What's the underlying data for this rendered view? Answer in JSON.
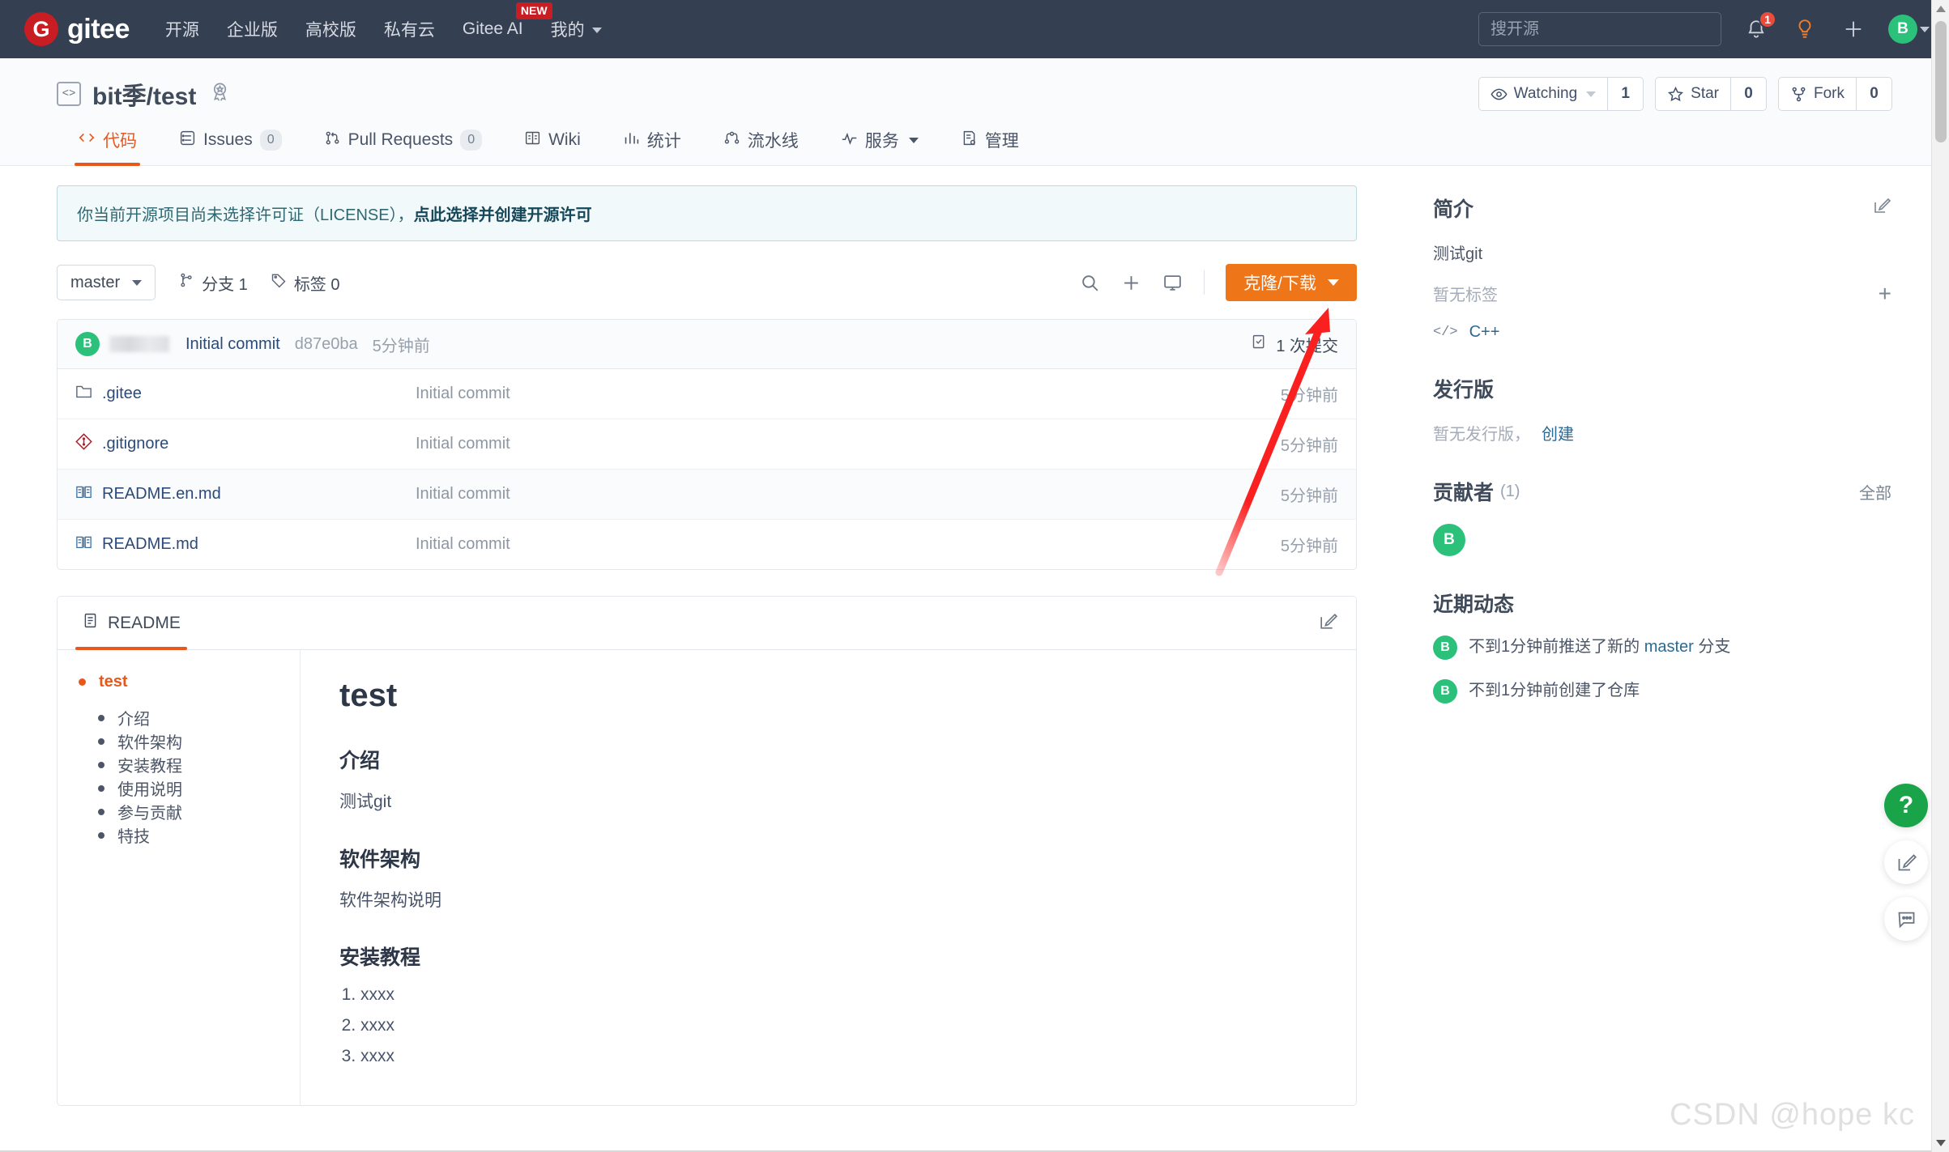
{
  "topnav": {
    "brand": "gitee",
    "logo_letter": "G",
    "links": [
      {
        "label": "开源"
      },
      {
        "label": "企业版"
      },
      {
        "label": "高校版"
      },
      {
        "label": "私有云"
      },
      {
        "label": "Gitee AI",
        "badge": "NEW"
      },
      {
        "label": "我的",
        "dropdown": true
      }
    ],
    "search_placeholder": "搜开源",
    "notification_count": "1",
    "avatar_letter": "B"
  },
  "repo": {
    "name": "bit季/test",
    "watching_label": "Watching",
    "watching_count": "1",
    "star_label": "Star",
    "star_count": "0",
    "fork_label": "Fork",
    "fork_count": "0",
    "tabs": [
      {
        "label": "代码",
        "icon": "code-icon",
        "active": true
      },
      {
        "label": "Issues",
        "icon": "issue-icon",
        "count": "0"
      },
      {
        "label": "Pull Requests",
        "icon": "pr-icon",
        "count": "0"
      },
      {
        "label": "Wiki",
        "icon": "wiki-icon"
      },
      {
        "label": "统计",
        "icon": "stats-icon"
      },
      {
        "label": "流水线",
        "icon": "pipeline-icon"
      },
      {
        "label": "服务",
        "icon": "service-icon",
        "dropdown": true
      },
      {
        "label": "管理",
        "icon": "manage-icon"
      }
    ]
  },
  "notice": {
    "text": "你当前开源项目尚未选择许可证（LICENSE），",
    "link": "点此选择并创建开源许可"
  },
  "toolbar": {
    "branch": "master",
    "branches_label": "分支 1",
    "tags_label": "标签 0",
    "clone_label": "克隆/下载"
  },
  "commit": {
    "avatar_letter": "B",
    "message": "Initial commit",
    "hash": "d87e0ba",
    "time": "5分钟前",
    "count_label": "1 次提交"
  },
  "files": [
    {
      "name": ".gitee",
      "icon": "folder-icon",
      "commit": "Initial commit",
      "time": "5分钟前",
      "alt": false
    },
    {
      "name": ".gitignore",
      "icon": "git-icon",
      "commit": "Initial commit",
      "time": "5分钟前",
      "alt": false
    },
    {
      "name": "README.en.md",
      "icon": "book-icon",
      "commit": "Initial commit",
      "time": "5分钟前",
      "alt": true
    },
    {
      "name": "README.md",
      "icon": "book-icon",
      "commit": "Initial commit",
      "time": "5分钟前",
      "alt": false
    }
  ],
  "readme": {
    "tab_label": "README",
    "toc_root": "test",
    "toc_items": [
      "介绍",
      "软件架构",
      "安装教程",
      "使用说明",
      "参与贡献",
      "特技"
    ],
    "title": "test",
    "sections": [
      {
        "heading": "介绍",
        "body": "测试git"
      },
      {
        "heading": "软件架构",
        "body": "软件架构说明"
      }
    ],
    "install_heading": "安装教程",
    "install_steps": [
      "xxxx",
      "xxxx",
      "xxxx"
    ]
  },
  "sidebar": {
    "about_title": "简介",
    "about_text": "测试git",
    "no_tags": "暂无标签",
    "language": "C++",
    "release_title": "发行版",
    "no_release": "暂无发行版，",
    "create_link": "创建",
    "contrib_title": "贡献者",
    "contrib_count": "(1)",
    "contrib_all": "全部",
    "contrib_avatars": [
      "B"
    ],
    "activity_title": "近期动态",
    "activities": [
      {
        "avatar": "B",
        "prefix": "不到1分钟前推送了新的 ",
        "link": "master",
        "suffix": " 分支"
      },
      {
        "avatar": "B",
        "prefix": "不到1分钟前创建了仓库",
        "link": "",
        "suffix": ""
      }
    ]
  },
  "fabs": [
    {
      "name": "help-fab",
      "glyph": "?"
    },
    {
      "name": "feedback-fab",
      "glyph": "edit"
    },
    {
      "name": "chat-fab",
      "glyph": "chat"
    }
  ],
  "watermark": "CSDN @hope kc",
  "colors": {
    "nav_bg": "#343f51",
    "accent_orange": "#e8581c",
    "clone_orange": "#ef7519",
    "green": "#2bc17b",
    "link_blue": "#2b4a7a",
    "annotation_red": "#fb2020"
  }
}
